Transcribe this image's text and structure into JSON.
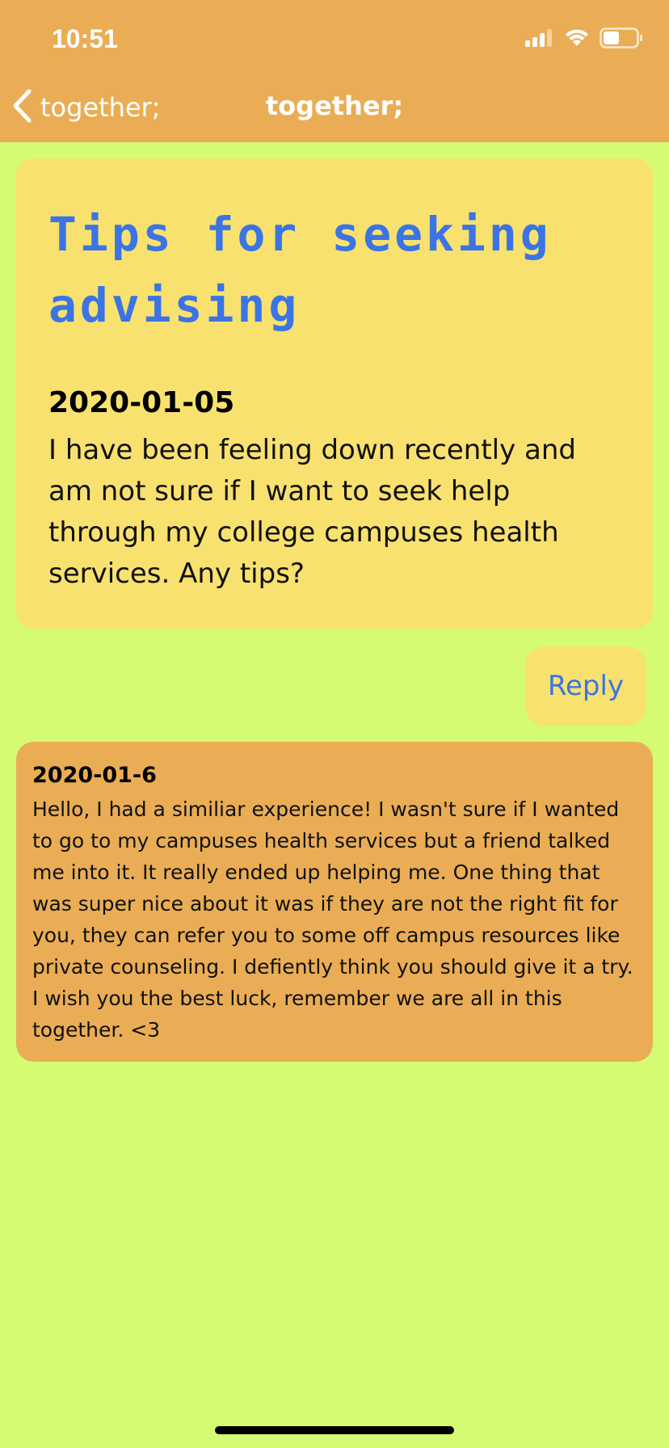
{
  "status_bar": {
    "time": "10:51",
    "icons": [
      "signal-icon",
      "wifi-icon",
      "battery-icon"
    ]
  },
  "nav": {
    "back_label": "together;",
    "title": "together;",
    "back_icon": "chevron-left-icon"
  },
  "post": {
    "title": "Tips for seeking advising",
    "date": "2020-01-05",
    "body": "I have been feeling down recently and am not sure if  I want to seek help through my college campuses health services. Any tips?"
  },
  "reply_button": {
    "label": "Reply"
  },
  "replies": [
    {
      "date": "2020-01-6",
      "body": "Hello,  I had a similiar experience!  I wasn't sure if  I wanted to go to my campuses health services but a friend talked me into it.  It really ended up helping me. One thing that was super nice about it was if they are not the right fit for you, they can refer you to some off campus resources like private counseling.  I defiently think you should give it a try. I wish you the best luck, remember we are all in this together. <3"
    }
  ],
  "colors": {
    "header_bg": "#eaad55",
    "page_bg": "#d5fb73",
    "post_card_bg": "#f8e16f",
    "reply_card_bg": "#eaad55",
    "accent_blue": "#3b74e4"
  }
}
